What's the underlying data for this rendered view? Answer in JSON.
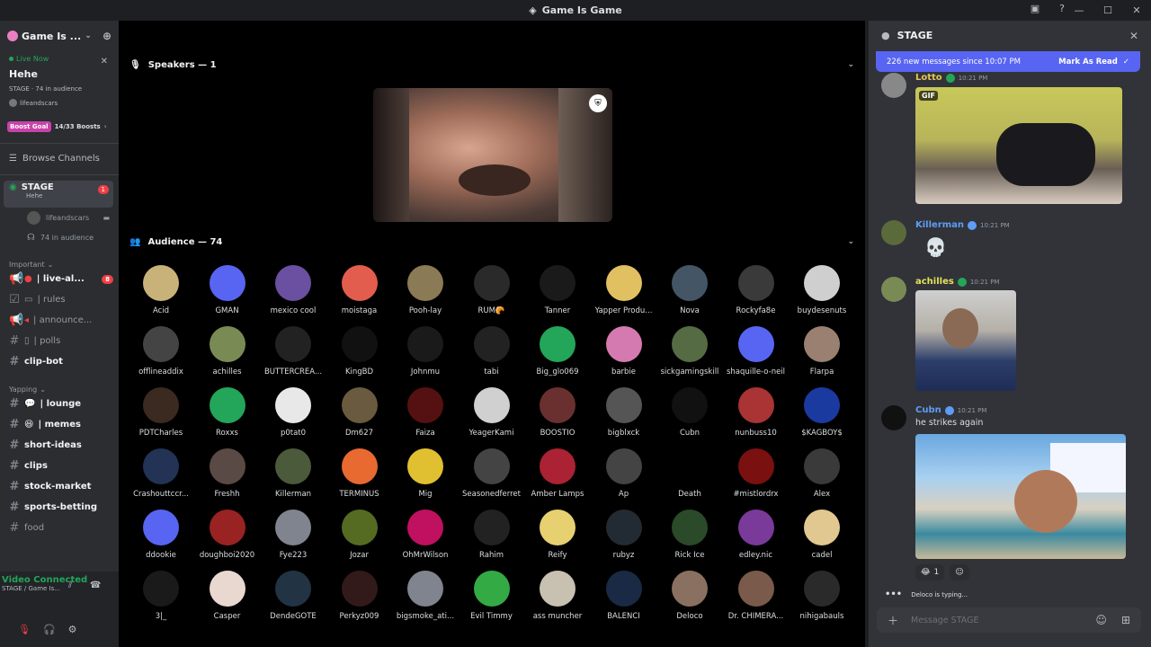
{
  "window": {
    "title": "Game Is Game"
  },
  "sidebar": {
    "guild_name": "Game Is ...",
    "live": {
      "label": "Live Now",
      "title": "Hehe",
      "meta": "STAGE · 74 in audience",
      "host": "lifeandscars"
    },
    "boost": {
      "label": "Boost Goal",
      "progress": "14/33 Boosts"
    },
    "browse": "Browse Channels",
    "stage": {
      "name": "STAGE",
      "sub": "Hehe",
      "badge": "1"
    },
    "stage_children": [
      "lifeandscars",
      "74 in audience"
    ],
    "cat_important": "Important",
    "important": [
      {
        "label": "| live-al...",
        "badge": "8"
      },
      {
        "label": "| rules"
      },
      {
        "label": "| announce..."
      },
      {
        "label": "| polls"
      }
    ],
    "clipbot": "clip-bot",
    "cat_yapping": "Yapping",
    "yapping": [
      "| lounge",
      "| memes",
      "short-ideas",
      "clips",
      "stock-market",
      "sports-betting",
      "food"
    ],
    "voice": {
      "line1": "Video Connected",
      "line2": "STAGE / Game Is..."
    }
  },
  "main": {
    "speakers_header": "Speakers — 1",
    "audience_header": "Audience — 74",
    "audience": [
      {
        "name": "Acid",
        "color": "#c9b27a"
      },
      {
        "name": "GMAN",
        "color": "#5865f2"
      },
      {
        "name": "mexico cool",
        "color": "#6b4fa0"
      },
      {
        "name": "moistaga",
        "color": "#e35d4f"
      },
      {
        "name": "Pooh-lay",
        "color": "#8a7a55"
      },
      {
        "name": "RUM🥐",
        "color": "#2a2a2a"
      },
      {
        "name": "Tanner",
        "color": "#1a1a1a"
      },
      {
        "name": "Yapper Produ...",
        "color": "#e0c060"
      },
      {
        "name": "Nova",
        "color": "#445566"
      },
      {
        "name": "Rockyfa8e",
        "color": "#3a3a3a"
      },
      {
        "name": "buydesenuts",
        "color": "#cfcfcf"
      },
      {
        "name": "offlineaddix",
        "color": "#444"
      },
      {
        "name": "achilles",
        "color": "#7a8a55"
      },
      {
        "name": "BUTTERCREA...",
        "color": "#222"
      },
      {
        "name": "KingBD",
        "color": "#111"
      },
      {
        "name": "Johnmu",
        "color": "#1a1a1a"
      },
      {
        "name": "tabi",
        "color": "#222"
      },
      {
        "name": "Big_glo069",
        "color": "#23a55a"
      },
      {
        "name": "barbie",
        "color": "#d57ab0"
      },
      {
        "name": "sickgamingskill",
        "color": "#556b44"
      },
      {
        "name": "shaquille-o-neil",
        "color": "#5865f2"
      },
      {
        "name": "Flarpa",
        "color": "#9a8070"
      },
      {
        "name": "PDTCharles",
        "color": "#3a2a20"
      },
      {
        "name": "Roxxs",
        "color": "#23a55a"
      },
      {
        "name": "p0tat0",
        "color": "#e8e8e8"
      },
      {
        "name": "Dm627",
        "color": "#6a5a40"
      },
      {
        "name": "Faiza",
        "color": "#551111"
      },
      {
        "name": "YeagerKami",
        "color": "#d0d0d0"
      },
      {
        "name": "BOOSTIO",
        "color": "#6a3030"
      },
      {
        "name": "bigblxck",
        "color": "#555"
      },
      {
        "name": "Cubn",
        "color": "#111"
      },
      {
        "name": "nunbuss10",
        "color": "#aa3333"
      },
      {
        "name": "$KAGBOY$",
        "color": "#1a3aa0"
      },
      {
        "name": "Crashouttccr...",
        "color": "#223355"
      },
      {
        "name": "Freshh",
        "color": "#5a4a45"
      },
      {
        "name": "Killerman",
        "color": "#4a5a3a"
      },
      {
        "name": "TERMINUS",
        "color": "#e86a30"
      },
      {
        "name": "Mig",
        "color": "#e0c030"
      },
      {
        "name": "Seasonedferret",
        "color": "#444"
      },
      {
        "name": "Amber Lamps",
        "color": "#aa2233"
      },
      {
        "name": "Ap",
        "color": "#444"
      },
      {
        "name": "Death",
        "color": "#000"
      },
      {
        "name": "#mistlordrx",
        "color": "#7a1010"
      },
      {
        "name": "Alex",
        "color": "#3a3a3a"
      },
      {
        "name": "ddookie",
        "color": "#5865f2"
      },
      {
        "name": "doughboi2020",
        "color": "#992222"
      },
      {
        "name": "Fye223",
        "color": "#80848e"
      },
      {
        "name": "Jozar",
        "color": "#556b22"
      },
      {
        "name": "OhMrWilson",
        "color": "#c01060"
      },
      {
        "name": "Rahim",
        "color": "#222"
      },
      {
        "name": "Reify",
        "color": "#e6d070"
      },
      {
        "name": "rubyz",
        "color": "#222a33"
      },
      {
        "name": "Rick Ice",
        "color": "#2a4a2a"
      },
      {
        "name": "edley.nic",
        "color": "#7a3a9a"
      },
      {
        "name": "cadel",
        "color": "#e0c890"
      },
      {
        "name": "3|_",
        "color": "#1a1a1a"
      },
      {
        "name": "Casper",
        "color": "#e8d8d0"
      },
      {
        "name": "DendeGOTE",
        "color": "#223344"
      },
      {
        "name": "Perkyz009",
        "color": "#331a1a"
      },
      {
        "name": "bigsmoke_ati...",
        "color": "#80848e"
      },
      {
        "name": "Evil Timmy",
        "color": "#33aa44"
      },
      {
        "name": "ass muncher",
        "color": "#c8c0b0"
      },
      {
        "name": "BALENCI",
        "color": "#1a2a44"
      },
      {
        "name": "Deloco",
        "color": "#8a7060"
      },
      {
        "name": "Dr. CHIMERA...",
        "color": "#7a5a4a"
      },
      {
        "name": "nihigabauls",
        "color": "#2a2a2a"
      }
    ]
  },
  "chat": {
    "title": "STAGE",
    "new_messages": "226 new messages since 10:07 PM",
    "mark_read": "Mark As Read",
    "messages": [
      {
        "author": "Lotto",
        "color": "#e3c45a",
        "time": "10:21 PM",
        "text": "",
        "gif": "GIF"
      },
      {
        "author": "Killerman",
        "color": "#5e9cf5",
        "time": "10:21 PM",
        "text": ""
      },
      {
        "author": "achilles",
        "color": "#e3e35a",
        "time": "10:21 PM",
        "text": ""
      },
      {
        "author": "Cubn",
        "color": "#5e9cf5",
        "time": "10:21 PM",
        "text": "he strikes again"
      }
    ],
    "reactions": [
      {
        "emoji": "😂",
        "count": "1"
      }
    ],
    "typing": "Deloco is typing...",
    "input_placeholder": "Message STAGE"
  }
}
